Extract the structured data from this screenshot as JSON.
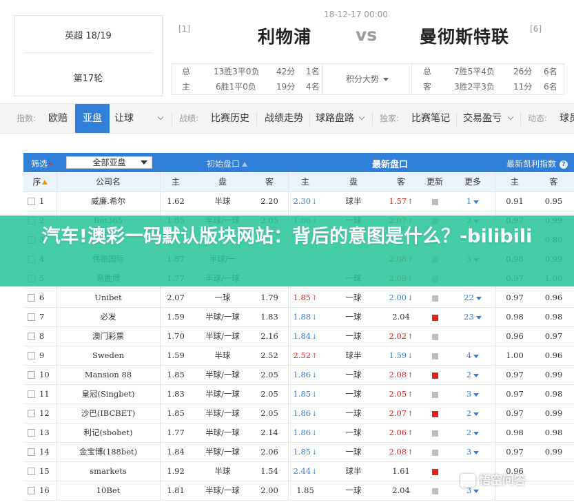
{
  "match": {
    "league": "英超 18/19",
    "round": "第17轮",
    "time": "18-12-17 00:00",
    "home_rank": "[1]",
    "home_team": "利物浦",
    "vs": "vs",
    "away_team": "曼彻斯特联",
    "away_rank": "[6]"
  },
  "stats": {
    "home_rows": [
      {
        "label": "总",
        "record": "13胜3平0负",
        "points": "42分",
        "rank": "1名"
      },
      {
        "label": "主",
        "record": "6胜1平0负",
        "points": "19分",
        "rank": "4名"
      }
    ],
    "trend_label": "积分大势",
    "away_rows": [
      {
        "label": "总",
        "record": "7胜5平4负",
        "points": "26分",
        "rank": "6名"
      },
      {
        "label": "客",
        "record": "3胜2平3负",
        "points": "11分",
        "rank": "6名"
      }
    ]
  },
  "nav": {
    "index_label": "指数:",
    "europe": "欧赔",
    "asian": "亚盘",
    "handicap": "让球",
    "battle_label": "战绩:",
    "history": "比赛历史",
    "trend": "战绩走势",
    "road": "球路盘路",
    "exclusive_label": "独家:",
    "notes": "比赛笔记",
    "profit": "交易盈亏",
    "dynamic_label": "动态:",
    "scene": "球员"
  },
  "table": {
    "filter_label": "筛选",
    "filter_value": "全部亚盘",
    "initial_label": "初始盘口",
    "latest_label": "最新盘口",
    "kelly_label": "最新凯利指数",
    "kelly_icon": "?",
    "headers": {
      "seq": "序",
      "company": "公司名",
      "home": "主",
      "line": "盘",
      "away": "客",
      "home2": "主",
      "line2": "盘",
      "away2": "客",
      "update": "更新",
      "more": "更多",
      "k_home": "主",
      "k_away": "客"
    },
    "rows": [
      {
        "no": "1",
        "company": "威廉.希尔",
        "ih": "1.62",
        "il": "半球",
        "ia": "2.20",
        "lh": "2.30",
        "lh_dir": "down",
        "ll": "球半",
        "la": "1.57",
        "la_dir": "up",
        "upd": "grey",
        "more": "1",
        "kh": "0.91",
        "ka": "0.95"
      },
      {
        "no": "2",
        "company": "Bet365",
        "ih": "1.85",
        "il": "半球/一球",
        "ia": "2.05",
        "lh": "1.86",
        "lh_dir": "down",
        "ll": "一球",
        "la": "2.07",
        "la_dir": "up",
        "upd": "grey",
        "more": "2",
        "kh": "0.97",
        "ka": "0.99"
      },
      {
        "no": "3",
        "company": "",
        "ih": "",
        "il": "",
        "ia": "",
        "lh": "",
        "lh_dir": "",
        "ll": "",
        "la": "",
        "la_dir": "",
        "upd": "grey",
        "more": "",
        "kh": "",
        "ka": "0.80"
      },
      {
        "no": "4",
        "company": "伟德国际",
        "ih": "1.87",
        "il": "半球/一",
        "ia": "",
        "lh": "",
        "lh_dir": "",
        "ll": "",
        "la": "2.08",
        "la_dir": "up",
        "upd": "grey",
        "more": "3",
        "kh": "0.98",
        "ka": "0.99"
      },
      {
        "no": "5",
        "company": "易胜博",
        "ih": "1.77",
        "il": "半球/一球",
        "ia": "",
        "lh": "",
        "lh_dir": "",
        "ll": "一球",
        "la": "2.09",
        "la_dir": "up",
        "upd": "grey",
        "more": "",
        "kh": "0.97",
        "ka": "1.00"
      },
      {
        "no": "6",
        "company": "Unibet",
        "ih": "2.07",
        "il": "一球",
        "ia": "1.79",
        "lh": "1.85",
        "lh_dir": "up",
        "ll": "一球",
        "la": "2.00",
        "la_dir": "down",
        "upd": "grey",
        "more": "22",
        "kh": "0.97",
        "ka": "0.96"
      },
      {
        "no": "7",
        "company": "必发",
        "ih": "1.59",
        "il": "半球/一球",
        "ia": "1.83",
        "lh": "1.88",
        "lh_dir": "down",
        "ll": "一球",
        "la": "2.04",
        "la_dir": "",
        "upd": "red",
        "more": "23",
        "kh": "0.98",
        "ka": "0.98"
      },
      {
        "no": "8",
        "company": "澳门彩票",
        "ih": "1.70",
        "il": "半球/一球",
        "ia": "2.16",
        "lh": "1.84",
        "lh_dir": "down",
        "ll": "一球",
        "la": "2.02",
        "la_dir": "up",
        "upd": "grey",
        "more": "",
        "kh": "0.96",
        "ka": "0.97"
      },
      {
        "no": "9",
        "company": "Sweden",
        "ih": "1.59",
        "il": "半球",
        "ia": "2.52",
        "lh": "2.52",
        "lh_dir": "up",
        "ll": "球半",
        "la": "1.59",
        "la_dir": "down",
        "upd": "grey",
        "more": "4",
        "kh": "1.00",
        "ka": "0.96"
      },
      {
        "no": "10",
        "company": "Mansion 88",
        "ih": "1.85",
        "il": "半球/一球",
        "ia": "2.05",
        "lh": "1.86",
        "lh_dir": "down",
        "ll": "一球",
        "la": "2.08",
        "la_dir": "up",
        "upd": "red",
        "more": "2",
        "kh": "0.97",
        "ka": "0.99"
      },
      {
        "no": "11",
        "company": "皇冠(Singbet)",
        "ih": "1.83",
        "il": "半球/一球",
        "ia": "2.05",
        "lh": "1.85",
        "lh_dir": "down",
        "ll": "一球",
        "la": "2.05",
        "la_dir": "up",
        "upd": "grey",
        "more": "3",
        "kh": "0.97",
        "ka": "0.98"
      },
      {
        "no": "12",
        "company": "沙巴(IBCBET)",
        "ih": "1.85",
        "il": "半球/一球",
        "ia": "2.05",
        "lh": "1.86",
        "lh_dir": "down",
        "ll": "一球",
        "la": "2.07",
        "la_dir": "up",
        "upd": "red",
        "more": "2",
        "kh": "0.97",
        "ka": "0.99"
      },
      {
        "no": "13",
        "company": "利记(sbobet)",
        "ih": "1.77",
        "il": "半球/一球",
        "ia": "2.14",
        "lh": "1.86",
        "lh_dir": "down",
        "ll": "一球",
        "la": "2.06",
        "la_dir": "up",
        "upd": "grey",
        "more": "2",
        "kh": "0.98",
        "ka": "0.98"
      },
      {
        "no": "14",
        "company": "金宝博(188bet)",
        "ih": "1.84",
        "il": "半球/一球",
        "ia": "2.06",
        "lh": "1.85",
        "lh_dir": "down",
        "ll": "一球",
        "la": "2.08",
        "la_dir": "up",
        "upd": "grey",
        "more": "3",
        "kh": "0.97",
        "ka": "0.99"
      },
      {
        "no": "15",
        "company": "smarkets",
        "ih": "1.92",
        "il": "半球",
        "ia": "1.54",
        "lh": "2.44",
        "lh_dir": "down",
        "ll": "球半",
        "la": "1.61",
        "la_dir": "",
        "upd": "red",
        "more": "",
        "kh": "0.96",
        "ka": ""
      },
      {
        "no": "16",
        "company": "10Bet",
        "ih": "1.81",
        "il": "半球/一球",
        "ia": "2.00",
        "lh": "1.85",
        "lh_dir": "",
        "ll": "一球",
        "la": "2.04",
        "la_dir": "",
        "upd": "grey",
        "more": "3",
        "kh": "",
        "ka": ""
      }
    ]
  },
  "banner": {
    "title": "汽车!澳彩一码默认版块网站：背后的意图是什么？-bilibili"
  },
  "watermark": {
    "text": "悟空问答"
  },
  "colors": {
    "accent": "#2f7fd8",
    "up": "#e02020",
    "down": "#2f7fd8",
    "banner": "#24c496",
    "header_bg": "#eaf2fc"
  }
}
